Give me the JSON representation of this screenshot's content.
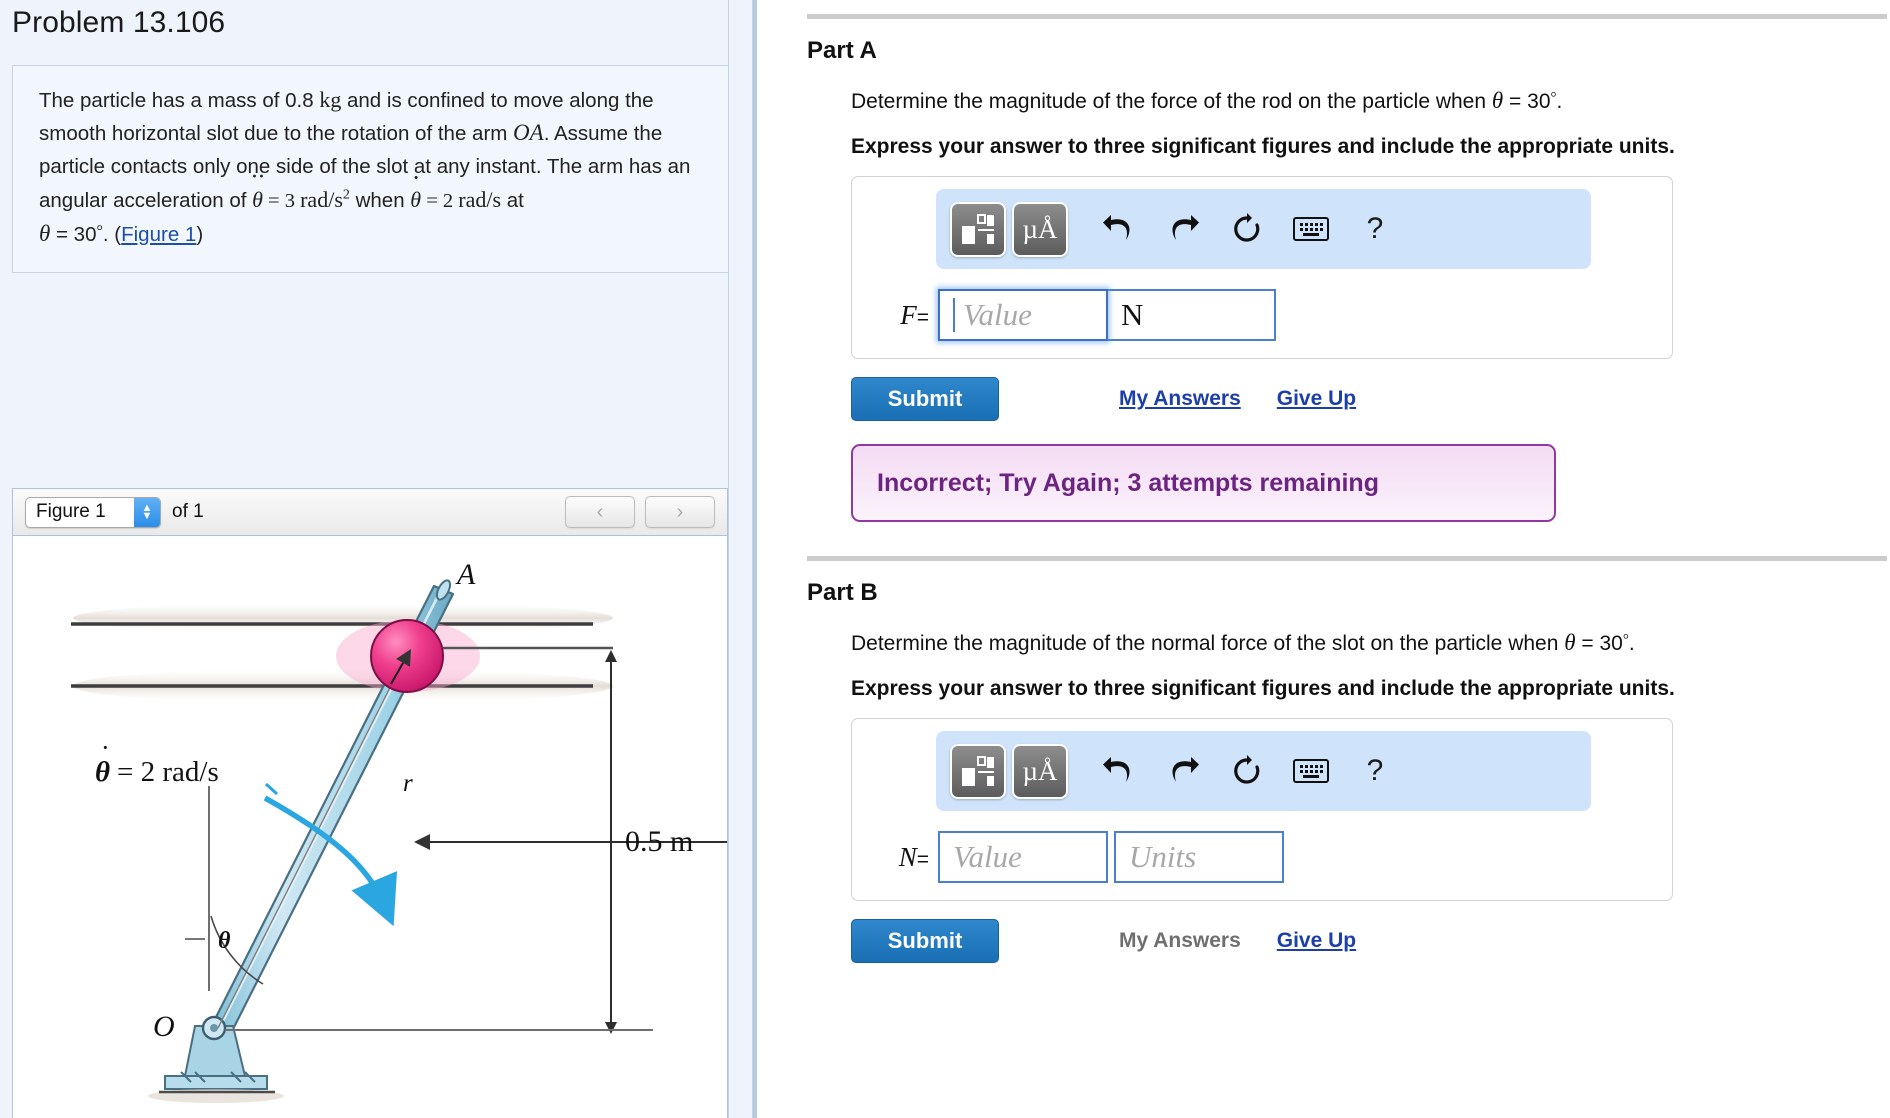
{
  "problem": {
    "title": "Problem 13.106",
    "statement_parts": {
      "s1": "The particle has a mass of 0.8 ",
      "kg": "kg",
      "s2": " and is confined to move along the smooth horizontal slot due to the rotation of the arm ",
      "OA": "OA",
      "s3": ". Assume the particle contacts only one side of the slot at any instant. The arm has an angular acceleration of ",
      "theta_ddot": "θ",
      "eq1": " = 3 ",
      "rad_s2_num": "rad",
      "rad_s2_den": "s",
      "rad_s2_sup": "2",
      "when": " when ",
      "theta_dot": "θ",
      "eq2": " = 2 ",
      "rad_s_num": "rad",
      "rad_s_den": "s",
      "at": " at ",
      "theta": "θ",
      "eq3": " = 30",
      "degree": "°",
      "period": ". (",
      "figure_link": "Figure 1",
      "close": ")"
    }
  },
  "figure_panel": {
    "selected_figure": "Figure 1",
    "of_label": "of 1",
    "prev_button": "‹",
    "next_button": "›",
    "diagram": {
      "label_A": "A",
      "label_O": "O",
      "label_r": "r",
      "label_theta": "θ",
      "label_theta_dot": "θ",
      "label_theta_dot_value": " = 2 rad/s",
      "label_dimension": "0.5 m",
      "rod_color": "#a8d4e8",
      "particle_color": "#e8357f"
    }
  },
  "parts": [
    {
      "id": "part-a",
      "title": "Part A",
      "question_prefix": "Determine the magnitude of the force of the rod on the particle when ",
      "question_theta": "θ",
      "question_eq": " = 30",
      "question_degree": "°",
      "question_suffix": ".",
      "instruction": "Express your answer to three significant figures and include the appropriate units.",
      "variable": "F",
      "equals": "=",
      "value_placeholder": "Value",
      "units_value": "N",
      "units_is_placeholder": false,
      "value_focused": true,
      "submit_label": "Submit",
      "my_answers_label": "My Answers",
      "my_answers_enabled": true,
      "give_up_label": "Give Up",
      "give_up_enabled": true,
      "feedback": "Incorrect; Try Again; 3 attempts remaining",
      "has_feedback": true
    },
    {
      "id": "part-b",
      "title": "Part B",
      "question_prefix": "Determine the magnitude of the normal force of the slot on the particle when ",
      "question_theta": "θ",
      "question_eq": " = 30",
      "question_degree": "°",
      "question_suffix": ".",
      "instruction": "Express your answer to three significant figures and include the appropriate units.",
      "variable": "N",
      "equals": "=",
      "value_placeholder": "Value",
      "units_value": "Units",
      "units_is_placeholder": true,
      "value_focused": false,
      "submit_label": "Submit",
      "my_answers_label": "My Answers",
      "my_answers_enabled": false,
      "give_up_label": "Give Up",
      "give_up_enabled": true,
      "feedback": "",
      "has_feedback": false
    }
  ],
  "eqn_toolbar": {
    "template_button": "template-icon",
    "units_button": "µÅ",
    "undo_button": "↶",
    "redo_button": "↷",
    "reset_button": "↻",
    "keyboard_button": "keyboard-icon",
    "help_button": "?"
  },
  "colors": {
    "accent_blue": "#1a6fb4",
    "link_blue": "#1d3fa8",
    "feedback_purple": "#6b2580",
    "panel_bg": "#eff4fc",
    "toolbar_bg": "#cfe3fb"
  }
}
